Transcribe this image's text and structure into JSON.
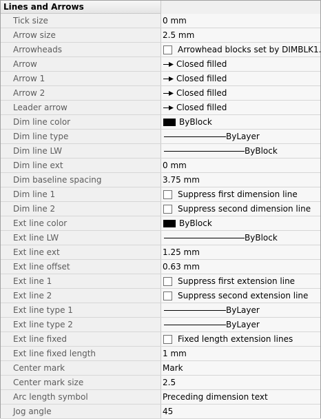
{
  "section": {
    "title": "Lines and Arrows"
  },
  "rows": [
    {
      "label": "Tick size",
      "value": "0 mm",
      "kind": "text"
    },
    {
      "label": "Arrow size",
      "value": "2.5 mm",
      "kind": "text"
    },
    {
      "label": "Arrowheads",
      "value": "Arrowhead blocks set by DIMBLK1...",
      "kind": "checkbox"
    },
    {
      "label": "Arrow",
      "value": "Closed filled",
      "kind": "arrow"
    },
    {
      "label": "Arrow 1",
      "value": "Closed filled",
      "kind": "arrow"
    },
    {
      "label": "Arrow 2",
      "value": "Closed filled",
      "kind": "arrow"
    },
    {
      "label": "Leader arrow",
      "value": "Closed filled",
      "kind": "arrow"
    },
    {
      "label": "Dim line color",
      "value": "ByBlock",
      "kind": "color"
    },
    {
      "label": "Dim line type",
      "value": "ByLayer",
      "kind": "linetype"
    },
    {
      "label": "Dim line LW",
      "value": "ByBlock",
      "kind": "lineweight"
    },
    {
      "label": "Dim line ext",
      "value": "0 mm",
      "kind": "text"
    },
    {
      "label": "Dim baseline spacing",
      "value": "3.75 mm",
      "kind": "text"
    },
    {
      "label": "Dim line 1",
      "value": "Suppress first dimension line",
      "kind": "checkbox"
    },
    {
      "label": "Dim line 2",
      "value": "Suppress second dimension line",
      "kind": "checkbox"
    },
    {
      "label": "Ext line color",
      "value": "ByBlock",
      "kind": "color"
    },
    {
      "label": "Ext line LW",
      "value": "ByBlock",
      "kind": "lineweight"
    },
    {
      "label": "Ext line ext",
      "value": "1.25 mm",
      "kind": "text"
    },
    {
      "label": "Ext line offset",
      "value": "0.63 mm",
      "kind": "text"
    },
    {
      "label": "Ext line 1",
      "value": "Suppress first extension line",
      "kind": "checkbox"
    },
    {
      "label": "Ext line 2",
      "value": "Suppress second extension line",
      "kind": "checkbox"
    },
    {
      "label": "Ext line type 1",
      "value": "ByLayer",
      "kind": "linetype"
    },
    {
      "label": "Ext line type 2",
      "value": "ByLayer",
      "kind": "linetype"
    },
    {
      "label": "Ext line fixed",
      "value": "Fixed length extension lines",
      "kind": "checkbox"
    },
    {
      "label": "Ext line fixed length",
      "value": "1 mm",
      "kind": "text"
    },
    {
      "label": "Center mark",
      "value": "Mark",
      "kind": "text"
    },
    {
      "label": "Center mark size",
      "value": "2.5",
      "kind": "text"
    },
    {
      "label": "Arc length symbol",
      "value": "Preceding dimension text",
      "kind": "text"
    },
    {
      "label": "Jog angle",
      "value": "45",
      "kind": "text"
    }
  ],
  "icons": {
    "checkbox": "checkbox-icon",
    "arrow": "closed-filled-arrow-icon",
    "color": "color-swatch-icon",
    "line": "line-preview-icon"
  },
  "colors": {
    "label_text": "#5c5c5c",
    "swatch": "#000000",
    "grid_line": "#d6d6d6"
  }
}
